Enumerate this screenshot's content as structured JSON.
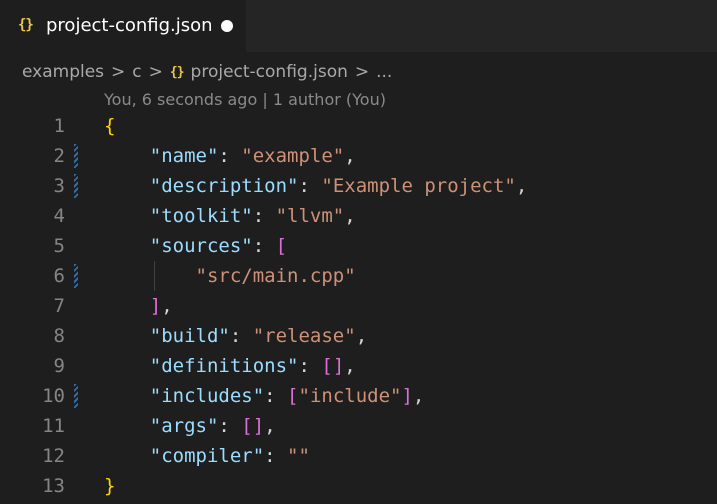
{
  "tab": {
    "icon": "json-braces-icon",
    "icon_glyph": "{}",
    "label": "project-config.json"
  },
  "breadcrumb": {
    "part1": "examples",
    "part2": "c",
    "icon_glyph": "{}",
    "file": "project-config.json",
    "ellipsis": "...",
    "separator": ">"
  },
  "codelens": {
    "text": "You, 6 seconds ago | 1 author (You)"
  },
  "lines": [
    {
      "num": "1"
    },
    {
      "num": "2",
      "key": "\"name\"",
      "value": "\"example\""
    },
    {
      "num": "3",
      "key": "\"description\"",
      "value": "\"Example project\""
    },
    {
      "num": "4",
      "key": "\"toolkit\"",
      "value": "\"llvm\""
    },
    {
      "num": "5",
      "key": "\"sources\""
    },
    {
      "num": "6",
      "value": "\"src/main.cpp\""
    },
    {
      "num": "7"
    },
    {
      "num": "8",
      "key": "\"build\"",
      "value": "\"release\""
    },
    {
      "num": "9",
      "key": "\"definitions\""
    },
    {
      "num": "10",
      "key": "\"includes\"",
      "value": "\"include\""
    },
    {
      "num": "11",
      "key": "\"args\""
    },
    {
      "num": "12",
      "key": "\"compiler\"",
      "value": "\"\""
    },
    {
      "num": "13"
    }
  ],
  "colors": {
    "key": "#9cdcfe",
    "string": "#ce9178",
    "bracket_level1": "#ffd700",
    "bracket_level2": "#da70d6",
    "gutter_modified": "#2f6ea8"
  }
}
